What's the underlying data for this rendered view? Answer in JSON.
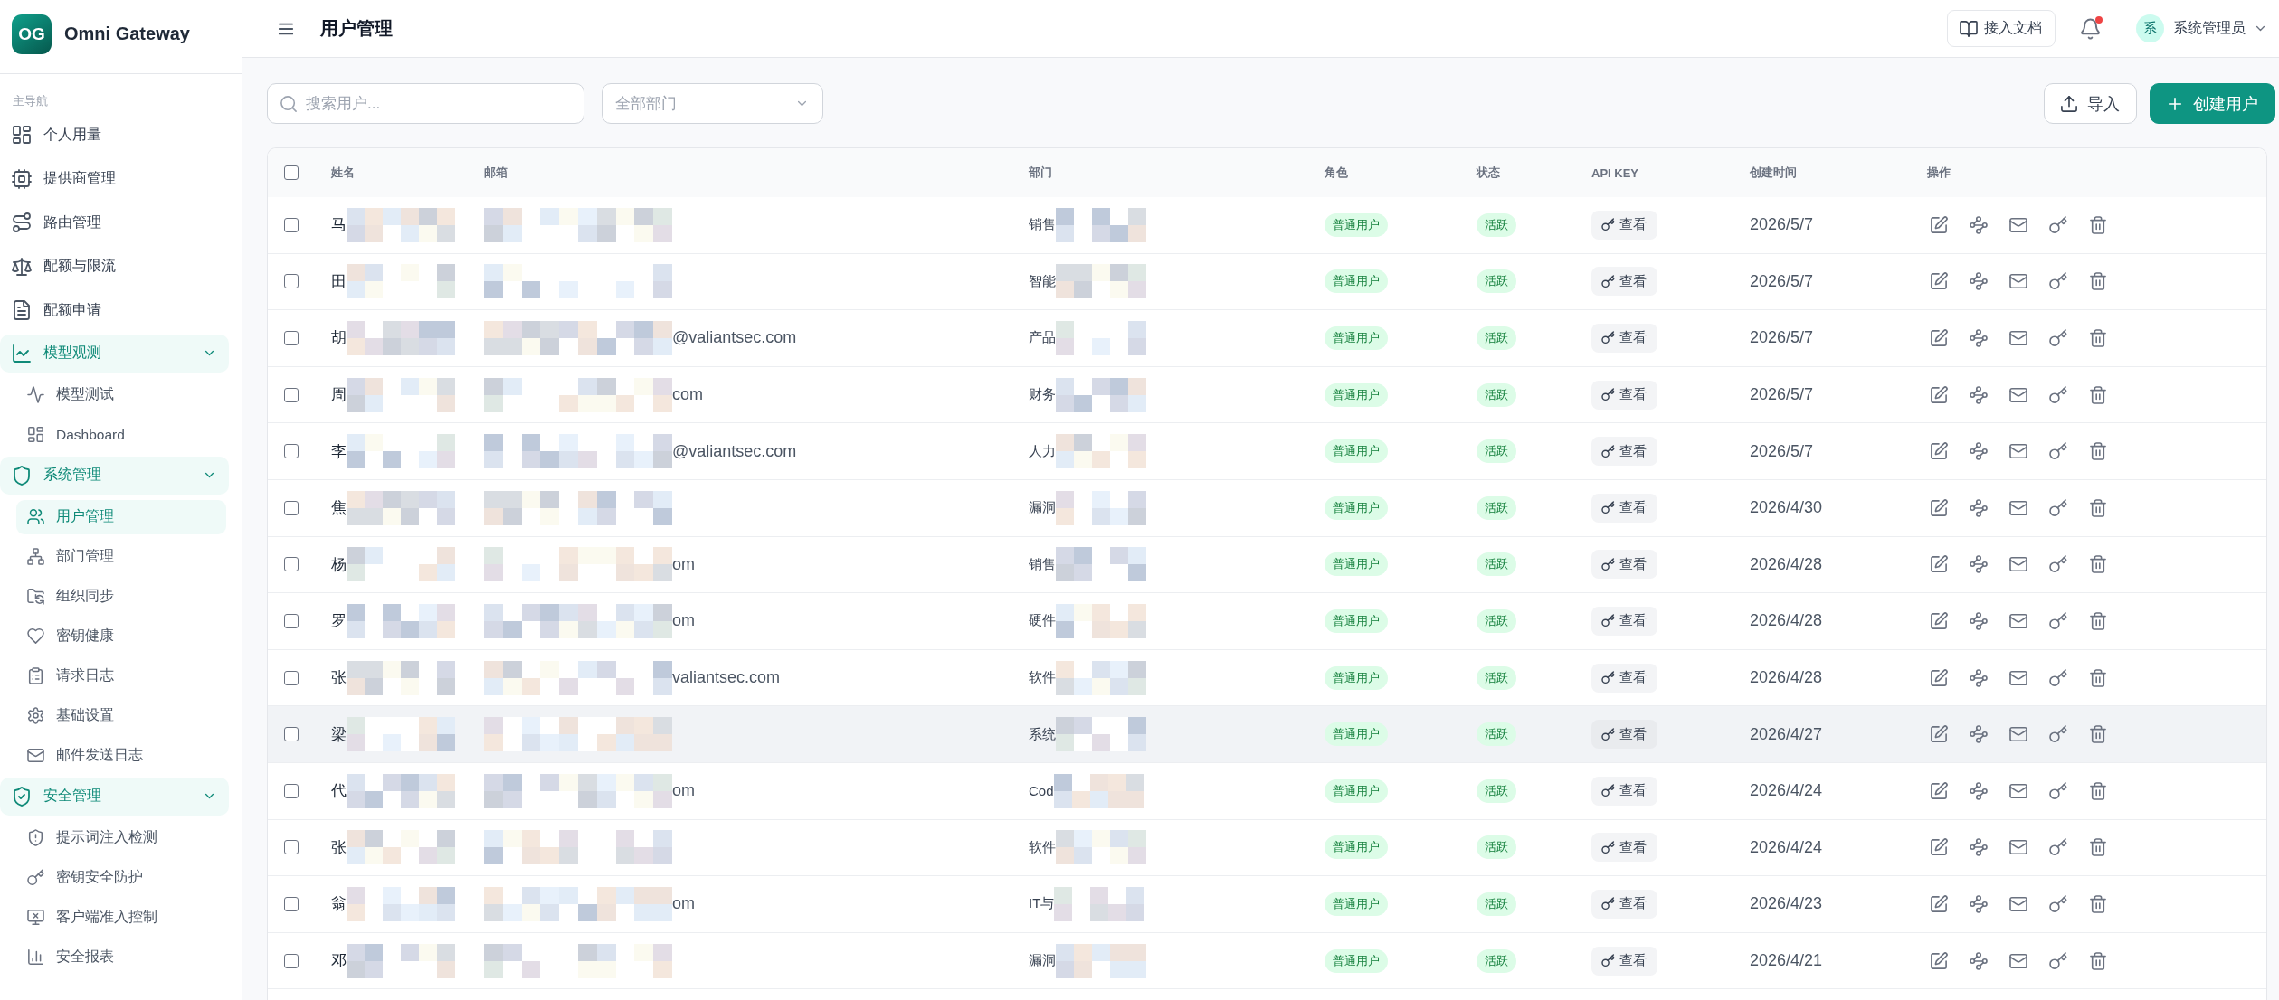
{
  "sidebar": {
    "logo": "OG",
    "brand": "Omni Gateway",
    "section_label": "主导航",
    "items": [
      {
        "label": "个人用量",
        "selected": false
      },
      {
        "label": "提供商管理",
        "selected": false
      },
      {
        "label": "路由管理",
        "selected": false
      },
      {
        "label": "配额与限流",
        "selected": false
      },
      {
        "label": "配额申请",
        "selected": false
      },
      {
        "label": "模型观测",
        "expanded": true,
        "children": [
          {
            "label": "模型测试",
            "selected": false
          },
          {
            "label": "Dashboard",
            "selected": false
          }
        ]
      },
      {
        "label": "系统管理",
        "expanded": true,
        "children": [
          {
            "label": "用户管理",
            "selected": true
          },
          {
            "label": "部门管理",
            "selected": false
          },
          {
            "label": "组织同步",
            "selected": false
          },
          {
            "label": "密钥健康",
            "selected": false
          },
          {
            "label": "请求日志",
            "selected": false
          },
          {
            "label": "基础设置",
            "selected": false
          },
          {
            "label": "邮件发送日志",
            "selected": false
          }
        ]
      },
      {
        "label": "安全管理",
        "expanded": true,
        "children": [
          {
            "label": "提示词注入检测",
            "selected": false
          },
          {
            "label": "密钥安全防护",
            "selected": false
          },
          {
            "label": "客户端准入控制",
            "selected": false
          },
          {
            "label": "安全报表",
            "selected": false
          }
        ]
      }
    ]
  },
  "header": {
    "title": "用户管理",
    "docs_button": "接入文档",
    "notifications": {
      "unread": true
    },
    "user": {
      "avatar": "系",
      "name": "系统管理员"
    }
  },
  "toolbar": {
    "search": {
      "placeholder": "搜索用户..."
    },
    "department_filter": {
      "placeholder": "全部部门"
    },
    "buttons": [
      {
        "label": "导入",
        "kind": "secondary"
      },
      {
        "label": "创建用户",
        "kind": "primary"
      }
    ]
  },
  "table": {
    "select_all": {
      "checked": false
    },
    "columns": [
      "姓名",
      "邮箱",
      "部门",
      "角色",
      "状态",
      "API KEY",
      "创建时间",
      "操作"
    ],
    "rows": [
      {
        "checked": false,
        "hovered": false,
        "name": "马",
        "department": "销售",
        "role": "普通用户",
        "status": "活跃",
        "api_key": "查看",
        "created_at": "2026/5/7"
      },
      {
        "checked": false,
        "hovered": false,
        "name": "田",
        "department": "智能",
        "role": "普通用户",
        "status": "活跃",
        "api_key": "查看",
        "created_at": "2026/5/7"
      },
      {
        "checked": false,
        "hovered": false,
        "name": "胡",
        "email": "@valiantsec.com",
        "department": "产品",
        "role": "普通用户",
        "status": "活跃",
        "api_key": "查看",
        "created_at": "2026/5/7"
      },
      {
        "checked": false,
        "hovered": false,
        "name": "周",
        "email": "com",
        "department": "财务",
        "role": "普通用户",
        "status": "活跃",
        "api_key": "查看",
        "created_at": "2026/5/7"
      },
      {
        "checked": false,
        "hovered": false,
        "name": "李",
        "email": "@valiantsec.com",
        "department": "人力",
        "role": "普通用户",
        "status": "活跃",
        "api_key": "查看",
        "created_at": "2026/5/7"
      },
      {
        "checked": false,
        "hovered": false,
        "name": "焦",
        "department": "漏洞",
        "role": "普通用户",
        "status": "活跃",
        "api_key": "查看",
        "created_at": "2026/4/30"
      },
      {
        "checked": false,
        "hovered": false,
        "name": "杨",
        "email": "om",
        "department": "销售",
        "role": "普通用户",
        "status": "活跃",
        "api_key": "查看",
        "created_at": "2026/4/28"
      },
      {
        "checked": false,
        "hovered": false,
        "name": "罗",
        "email": "om",
        "department": "硬件",
        "role": "普通用户",
        "status": "活跃",
        "api_key": "查看",
        "created_at": "2026/4/28"
      },
      {
        "checked": false,
        "hovered": false,
        "name": "张",
        "email": "valiantsec.com",
        "department": "软件",
        "role": "普通用户",
        "status": "活跃",
        "api_key": "查看",
        "created_at": "2026/4/28"
      },
      {
        "checked": false,
        "hovered": true,
        "name": "梁",
        "department": "系统",
        "role": "普通用户",
        "status": "活跃",
        "api_key": "查看",
        "created_at": "2026/4/27"
      },
      {
        "checked": false,
        "hovered": false,
        "name": "代",
        "email": "om",
        "department": "Cod",
        "role": "普通用户",
        "status": "活跃",
        "api_key": "查看",
        "created_at": "2026/4/24"
      },
      {
        "checked": false,
        "hovered": false,
        "name": "张",
        "department": "软件",
        "role": "普通用户",
        "status": "活跃",
        "api_key": "查看",
        "created_at": "2026/4/24"
      },
      {
        "checked": false,
        "hovered": false,
        "name": "翁",
        "email": "om",
        "department": "IT与",
        "role": "普通用户",
        "status": "活跃",
        "api_key": "查看",
        "created_at": "2026/4/23"
      },
      {
        "checked": false,
        "hovered": false,
        "name": "邓",
        "department": "漏洞",
        "role": "普通用户",
        "status": "活跃",
        "api_key": "查看",
        "created_at": "2026/4/21"
      }
    ]
  }
}
